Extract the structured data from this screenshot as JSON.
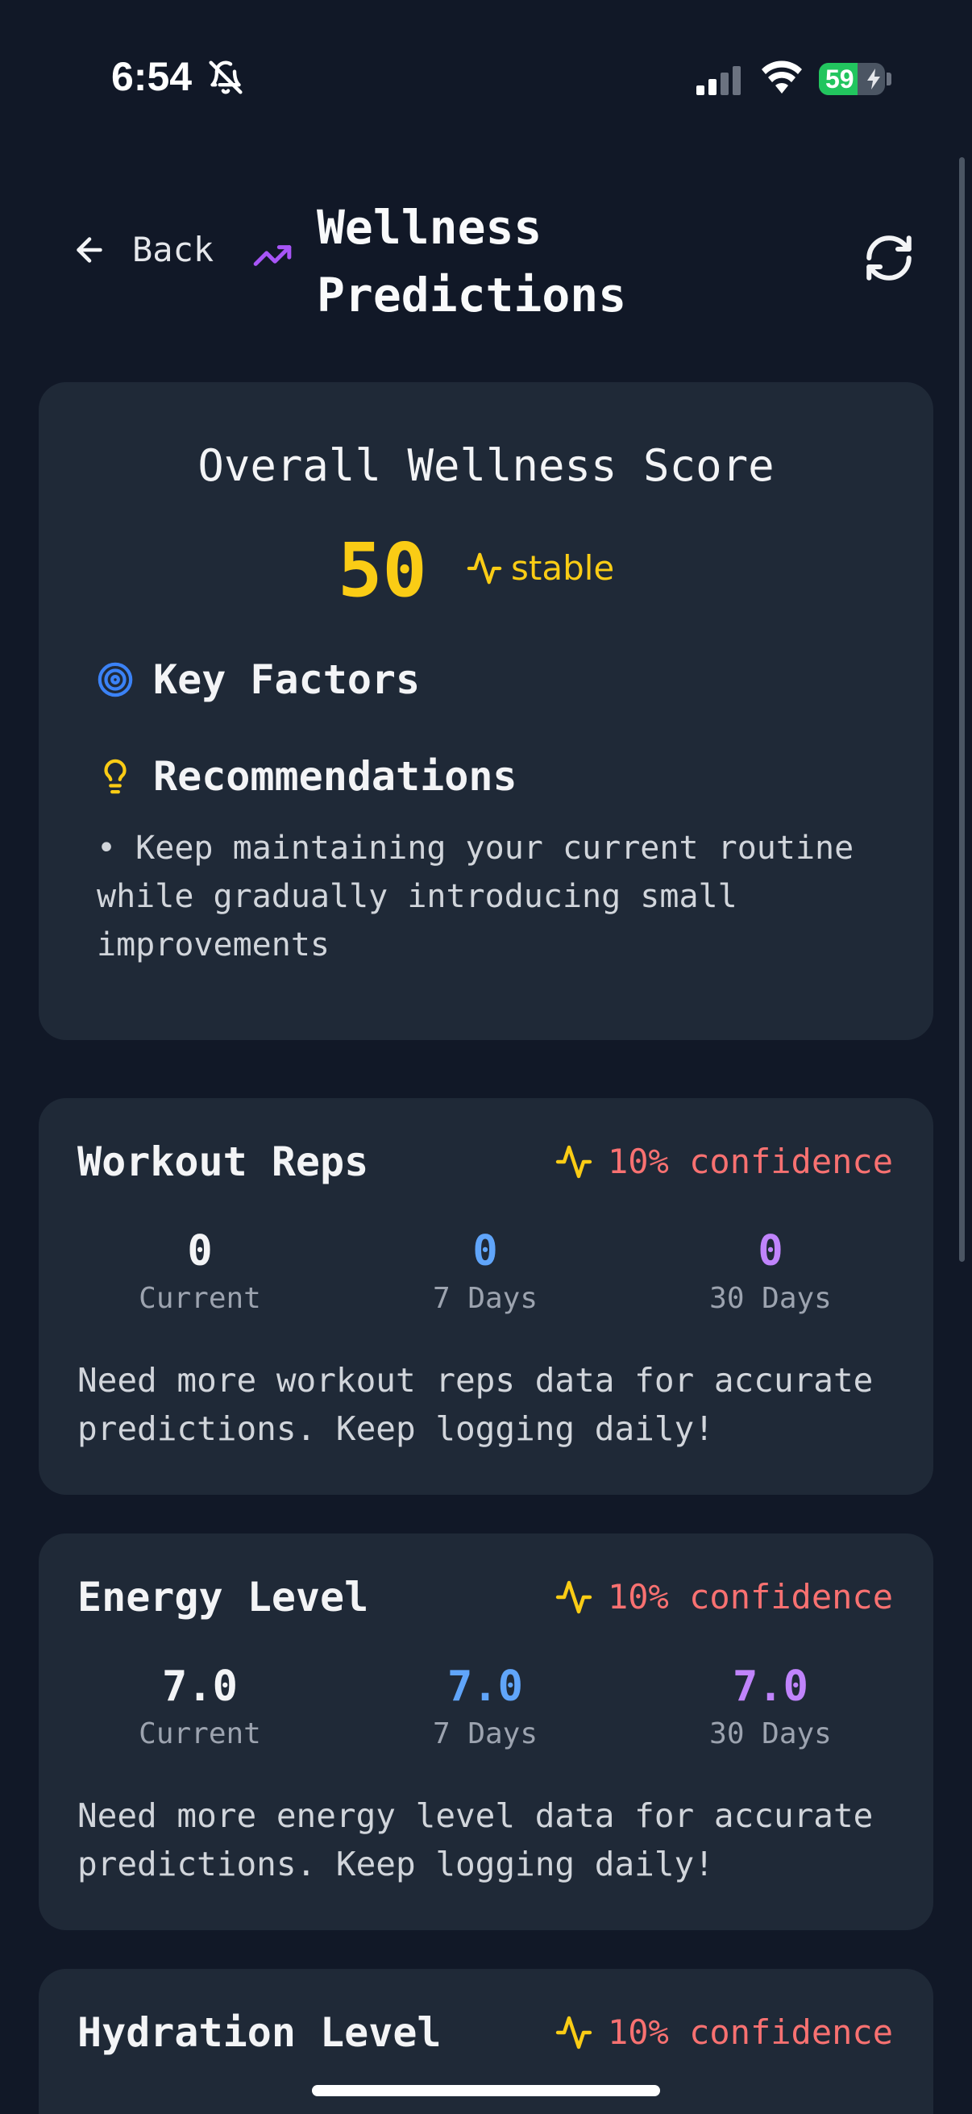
{
  "status_bar": {
    "time": "6:54",
    "battery_percent": "59",
    "battery_level": 0.59,
    "signal_bars_active": 2,
    "signal_bars_total": 4,
    "icons": [
      "bell-slash-icon",
      "signal-icon",
      "wifi-icon",
      "battery-charging-icon"
    ]
  },
  "header": {
    "back_label": "Back",
    "title": "Wellness Predictions",
    "icons": [
      "arrow-left-icon",
      "trending-up-icon",
      "refresh-icon"
    ]
  },
  "overall": {
    "title": "Overall Wellness Score",
    "score": "50",
    "trend": "stable",
    "key_factors_label": "Key Factors",
    "recommendations_label": "Recommendations",
    "recommendation_items": [
      "• Keep maintaining your current routine while gradually introducing small improvements"
    ],
    "icons": [
      "activity-icon",
      "target-icon",
      "lightbulb-icon"
    ]
  },
  "metrics": [
    {
      "name": "Workout Reps",
      "confidence": "10% confidence",
      "current": "0",
      "seven_days": "0",
      "thirty_days": "0",
      "current_label": "Current",
      "seven_label": "7 Days",
      "thirty_label": "30 Days",
      "description": "Need more workout reps data for accurate predictions. Keep logging daily!"
    },
    {
      "name": "Energy Level",
      "confidence": "10% confidence",
      "current": "7.0",
      "seven_days": "7.0",
      "thirty_days": "7.0",
      "current_label": "Current",
      "seven_label": "7 Days",
      "thirty_label": "30 Days",
      "description": "Need more energy level data for accurate predictions. Keep logging daily!"
    },
    {
      "name": "Hydration Level",
      "confidence": "10% confidence"
    }
  ],
  "colors": {
    "background": "#111827",
    "card": "#1f2937",
    "score_yellow": "#facc15",
    "confidence_red": "#f87171",
    "seven_day_blue": "#60a5fa",
    "thirty_day_purple": "#c084fc",
    "accent_purple": "#a855f7",
    "target_blue": "#3b82f6"
  }
}
